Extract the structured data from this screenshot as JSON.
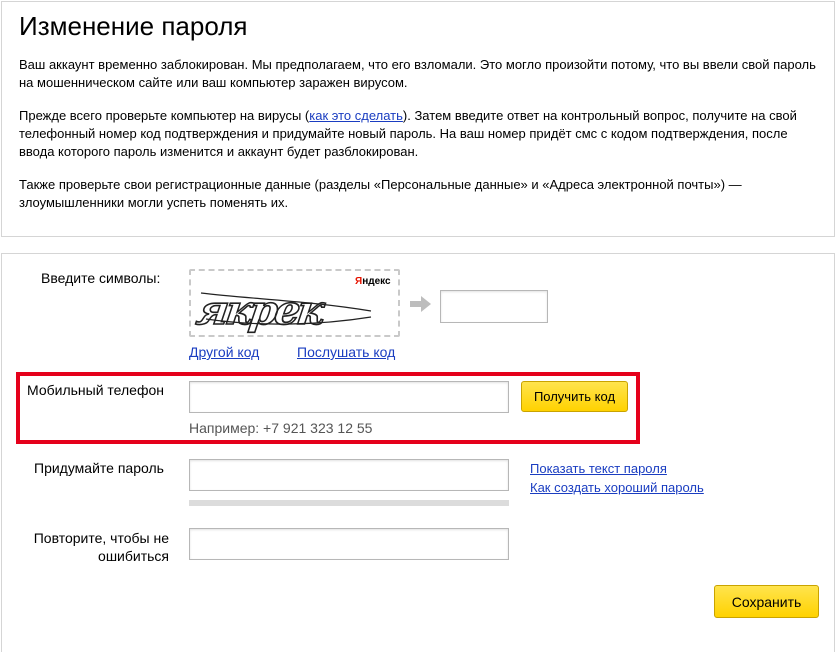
{
  "title": "Изменение пароля",
  "intro": {
    "p1": "Ваш аккаунт временно заблокирован. Мы предполагаем, что его взломали. Это могло произойти потому, что вы ввели свой пароль на мошенническом сайте или ваш компьютер заражен вирусом.",
    "p2_before": "Прежде всего проверьте компьютер на вирусы (",
    "p2_link": "как это сделать",
    "p2_after": "). Затем введите ответ на контрольный вопрос, получите на свой телефонный номер код подтверждения и придумайте новый пароль. На ваш номер придёт смс с кодом подтверждения, после ввода которого пароль изменится и аккаунт будет разблокирован.",
    "p3": "Также проверьте свои регистрационные данные (разделы «Персональные данные» и «Адреса электронной почты») — злоумышленники могли успеть поменять их."
  },
  "captcha": {
    "label": "Введите символы:",
    "image_text": "якрек",
    "brand_first": "Я",
    "brand_rest": "ндекс",
    "input_value": "",
    "other_code_link": "Другой код",
    "listen_link": "Послушать код"
  },
  "phone": {
    "label": "Мобильный телефон",
    "input_value": "",
    "button": "Получить код",
    "hint": "Например: +7 921 323 12 55"
  },
  "password": {
    "label": "Придумайте пароль",
    "input_value": "",
    "show_text_link": "Показать текст пароля",
    "how_to_link": "Как создать хороший пароль"
  },
  "repeat": {
    "label_line1": "Повторите, чтобы не",
    "label_line2": "ошибиться",
    "input_value": ""
  },
  "save_button": "Сохранить",
  "colors": {
    "link": "#1a3dc1",
    "button": "#ffd200",
    "highlight": "#e5001b"
  }
}
